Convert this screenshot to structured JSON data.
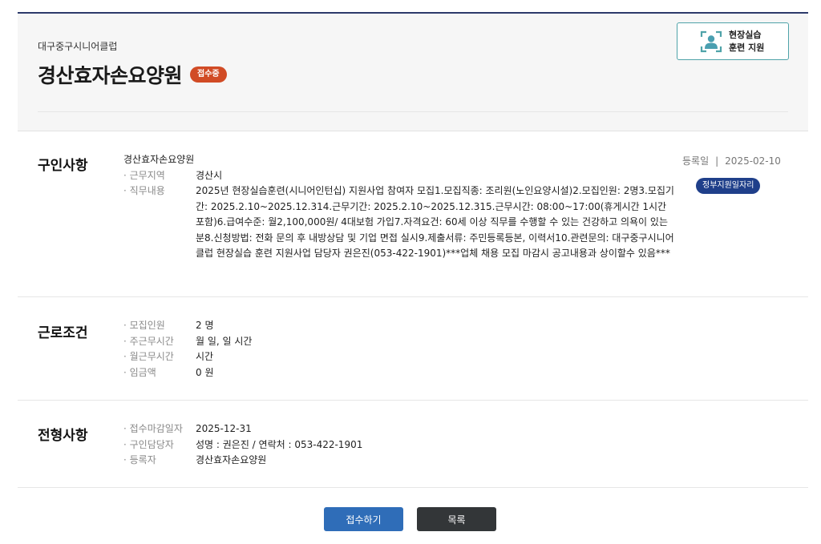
{
  "header": {
    "org": "대구중구시니어클럽",
    "title": "경산효자손요양원",
    "status_badge": "접수중",
    "support_line1": "현장실습",
    "support_line2": "훈련 지원"
  },
  "recruit": {
    "section_title": "구인사항",
    "company": "경산효자손요양원",
    "reg_label": "등록일",
    "reg_date": "2025-02-10",
    "gov_badge": "정부지원일자리",
    "rows": [
      {
        "label": "· 근무지역",
        "value": "경산시"
      },
      {
        "label": "· 직무내용",
        "value": "2025년 현장실습훈련(시니어인턴십) 지원사업 참여자 모집1.모집직종: 조리원(노인요양시설)2.모집인원: 2명3.모집기간: 2025.2.10~2025.12.314.근무기간: 2025.2.10~2025.12.315.근무시간: 08:00~17:00(휴게시간 1시간 포함)6.급여수준: 월2,100,000원/ 4대보험 가입7.자격요건: 60세 이상 직무를 수행할 수 있는 건강하고 의욕이 있는 분8.신청방법: 전화 문의 후 내방상담 및 기업 면접 실시9.제출서류: 주민등록등본, 이력서10.관련문의: 대구중구시니어클럽 현장실습 훈련 지원사업 담당자 권은진(053-422-1901)***업체 채용 모집 마감시 공고내용과 상이할수 있음***"
      }
    ]
  },
  "conditions": {
    "section_title": "근로조건",
    "rows": [
      {
        "label": "· 모집인원",
        "value": "2 명"
      },
      {
        "label": "· 주근무시간",
        "value": "월 일, 일 시간"
      },
      {
        "label": "· 월근무시간",
        "value": "시간"
      },
      {
        "label": "· 임금액",
        "value": "0 원"
      }
    ]
  },
  "selection": {
    "section_title": "전형사항",
    "rows": [
      {
        "label": "· 접수마감일자",
        "value": "2025-12-31"
      },
      {
        "label": "· 구인담당자",
        "value": "성명 : 권은진 / 연락처 : 053-422-1901"
      },
      {
        "label": "· 등록자",
        "value": "경산효자손요양원"
      }
    ]
  },
  "buttons": {
    "apply": "접수하기",
    "list": "목록"
  },
  "colors": {
    "status_badge": "#d14b25",
    "gov_badge": "#1f3f8a",
    "apply_button": "#2f6db8",
    "list_button": "#333638",
    "support_border": "#4fa3a9"
  }
}
